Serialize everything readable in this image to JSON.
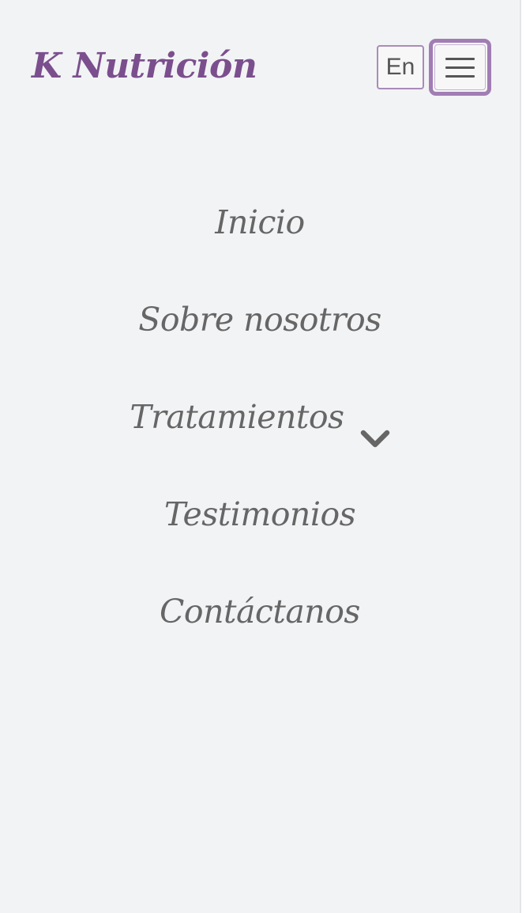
{
  "brand": {
    "name": "K Nutrición",
    "color": "#7b4f8d"
  },
  "header": {
    "language_label": "En",
    "menu_icon": "hamburger-menu-icon"
  },
  "nav": {
    "items": [
      {
        "label": "Inicio"
      },
      {
        "label": "Sobre nosotros"
      },
      {
        "label": "Tratamientos",
        "icon": "chevron-down-icon",
        "has_dropdown": true
      },
      {
        "label": "Testimonios"
      },
      {
        "label": "Contáctanos"
      }
    ],
    "text_color": "#666666"
  },
  "colors": {
    "background": "#f2f3f5",
    "accent": "#a17db4"
  }
}
